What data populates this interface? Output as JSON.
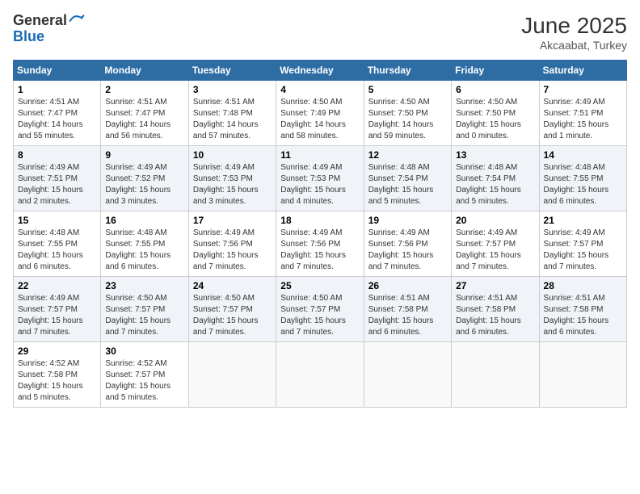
{
  "logo": {
    "general": "General",
    "blue": "Blue"
  },
  "title": "June 2025",
  "location": "Akcaabat, Turkey",
  "days_header": [
    "Sunday",
    "Monday",
    "Tuesday",
    "Wednesday",
    "Thursday",
    "Friday",
    "Saturday"
  ],
  "weeks": [
    [
      {
        "day": "1",
        "info": "Sunrise: 4:51 AM\nSunset: 7:47 PM\nDaylight: 14 hours\nand 55 minutes."
      },
      {
        "day": "2",
        "info": "Sunrise: 4:51 AM\nSunset: 7:47 PM\nDaylight: 14 hours\nand 56 minutes."
      },
      {
        "day": "3",
        "info": "Sunrise: 4:51 AM\nSunset: 7:48 PM\nDaylight: 14 hours\nand 57 minutes."
      },
      {
        "day": "4",
        "info": "Sunrise: 4:50 AM\nSunset: 7:49 PM\nDaylight: 14 hours\nand 58 minutes."
      },
      {
        "day": "5",
        "info": "Sunrise: 4:50 AM\nSunset: 7:50 PM\nDaylight: 14 hours\nand 59 minutes."
      },
      {
        "day": "6",
        "info": "Sunrise: 4:50 AM\nSunset: 7:50 PM\nDaylight: 15 hours\nand 0 minutes."
      },
      {
        "day": "7",
        "info": "Sunrise: 4:49 AM\nSunset: 7:51 PM\nDaylight: 15 hours\nand 1 minute."
      }
    ],
    [
      {
        "day": "8",
        "info": "Sunrise: 4:49 AM\nSunset: 7:51 PM\nDaylight: 15 hours\nand 2 minutes."
      },
      {
        "day": "9",
        "info": "Sunrise: 4:49 AM\nSunset: 7:52 PM\nDaylight: 15 hours\nand 3 minutes."
      },
      {
        "day": "10",
        "info": "Sunrise: 4:49 AM\nSunset: 7:53 PM\nDaylight: 15 hours\nand 3 minutes."
      },
      {
        "day": "11",
        "info": "Sunrise: 4:49 AM\nSunset: 7:53 PM\nDaylight: 15 hours\nand 4 minutes."
      },
      {
        "day": "12",
        "info": "Sunrise: 4:48 AM\nSunset: 7:54 PM\nDaylight: 15 hours\nand 5 minutes."
      },
      {
        "day": "13",
        "info": "Sunrise: 4:48 AM\nSunset: 7:54 PM\nDaylight: 15 hours\nand 5 minutes."
      },
      {
        "day": "14",
        "info": "Sunrise: 4:48 AM\nSunset: 7:55 PM\nDaylight: 15 hours\nand 6 minutes."
      }
    ],
    [
      {
        "day": "15",
        "info": "Sunrise: 4:48 AM\nSunset: 7:55 PM\nDaylight: 15 hours\nand 6 minutes."
      },
      {
        "day": "16",
        "info": "Sunrise: 4:48 AM\nSunset: 7:55 PM\nDaylight: 15 hours\nand 6 minutes."
      },
      {
        "day": "17",
        "info": "Sunrise: 4:49 AM\nSunset: 7:56 PM\nDaylight: 15 hours\nand 7 minutes."
      },
      {
        "day": "18",
        "info": "Sunrise: 4:49 AM\nSunset: 7:56 PM\nDaylight: 15 hours\nand 7 minutes."
      },
      {
        "day": "19",
        "info": "Sunrise: 4:49 AM\nSunset: 7:56 PM\nDaylight: 15 hours\nand 7 minutes."
      },
      {
        "day": "20",
        "info": "Sunrise: 4:49 AM\nSunset: 7:57 PM\nDaylight: 15 hours\nand 7 minutes."
      },
      {
        "day": "21",
        "info": "Sunrise: 4:49 AM\nSunset: 7:57 PM\nDaylight: 15 hours\nand 7 minutes."
      }
    ],
    [
      {
        "day": "22",
        "info": "Sunrise: 4:49 AM\nSunset: 7:57 PM\nDaylight: 15 hours\nand 7 minutes."
      },
      {
        "day": "23",
        "info": "Sunrise: 4:50 AM\nSunset: 7:57 PM\nDaylight: 15 hours\nand 7 minutes."
      },
      {
        "day": "24",
        "info": "Sunrise: 4:50 AM\nSunset: 7:57 PM\nDaylight: 15 hours\nand 7 minutes."
      },
      {
        "day": "25",
        "info": "Sunrise: 4:50 AM\nSunset: 7:57 PM\nDaylight: 15 hours\nand 7 minutes."
      },
      {
        "day": "26",
        "info": "Sunrise: 4:51 AM\nSunset: 7:58 PM\nDaylight: 15 hours\nand 6 minutes."
      },
      {
        "day": "27",
        "info": "Sunrise: 4:51 AM\nSunset: 7:58 PM\nDaylight: 15 hours\nand 6 minutes."
      },
      {
        "day": "28",
        "info": "Sunrise: 4:51 AM\nSunset: 7:58 PM\nDaylight: 15 hours\nand 6 minutes."
      }
    ],
    [
      {
        "day": "29",
        "info": "Sunrise: 4:52 AM\nSunset: 7:58 PM\nDaylight: 15 hours\nand 5 minutes."
      },
      {
        "day": "30",
        "info": "Sunrise: 4:52 AM\nSunset: 7:57 PM\nDaylight: 15 hours\nand 5 minutes."
      },
      {
        "day": "",
        "info": ""
      },
      {
        "day": "",
        "info": ""
      },
      {
        "day": "",
        "info": ""
      },
      {
        "day": "",
        "info": ""
      },
      {
        "day": "",
        "info": ""
      }
    ]
  ]
}
